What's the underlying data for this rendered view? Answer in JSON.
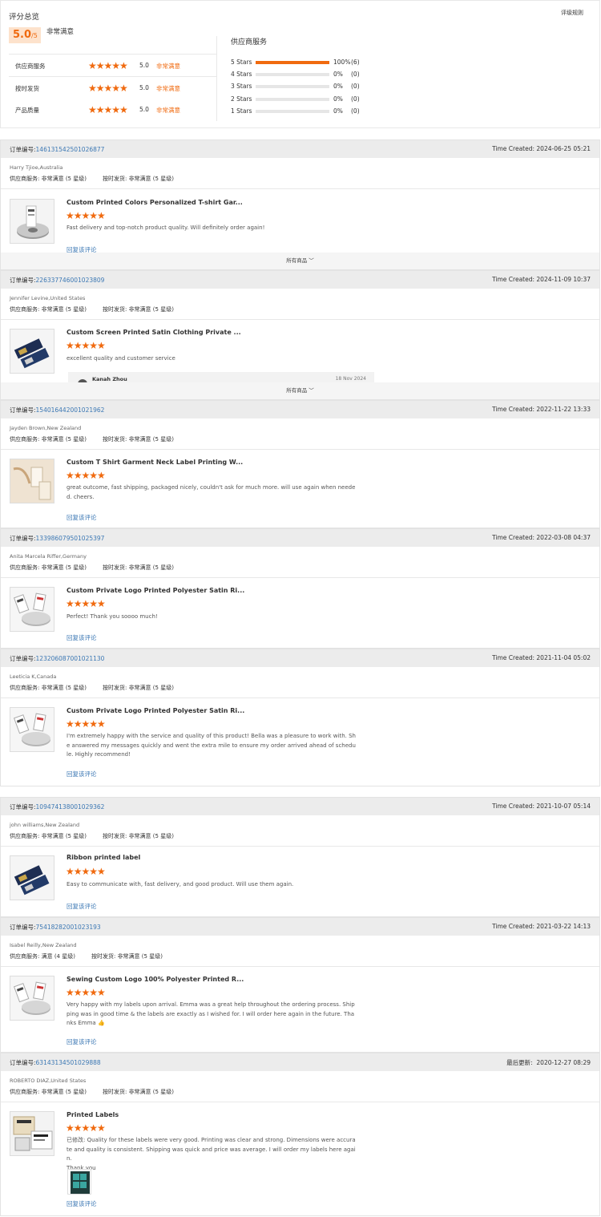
{
  "overview": {
    "title": "评分总览",
    "rules_link": "评级规则",
    "score": "5.0",
    "score_unit": "/5",
    "overall_text": "非常满意",
    "rows": [
      {
        "label": "供应商服务",
        "stars": "★★★★★",
        "value": "5.0",
        "text": "非常满意"
      },
      {
        "label": "按时发货",
        "stars": "★★★★★",
        "value": "5.0",
        "text": "非常满意"
      },
      {
        "label": "产品质量",
        "stars": "★★★★★",
        "value": "5.0",
        "text": "非常满意"
      }
    ],
    "supplier_service_title": "供应商服务",
    "distribution": [
      {
        "label": "5 Stars",
        "percent": "100%",
        "count": "(6)",
        "fraction": 1.0
      },
      {
        "label": "4 Stars",
        "percent": "0%",
        "count": "(0)",
        "fraction": 0
      },
      {
        "label": "3 Stars",
        "percent": "0%",
        "count": "(0)",
        "fraction": 0
      },
      {
        "label": "2 Stars",
        "percent": "0%",
        "count": "(0)",
        "fraction": 0
      },
      {
        "label": "1 Stars",
        "percent": "0%",
        "count": "(0)",
        "fraction": 0
      }
    ]
  },
  "labels": {
    "order_prefix": "订单编号:",
    "supplier_service": "供应商服务:",
    "on_time": "按时发货:",
    "reply": "回复该评论",
    "all_products": "所有商品"
  },
  "reviews": [
    {
      "order_no": "146131542501026877",
      "time_label": "Time Created:",
      "time": "2024-06-25 05:21",
      "user": "Harry Tjioe,Australia",
      "service_rating": "非常满意",
      "service_level": "(5 星级)",
      "ontime_rating": "非常满意",
      "ontime_level": "(5 星级)",
      "product": "Custom Printed Colors Personalized T-shirt Gar...",
      "stars": "★★★★★",
      "text": "Fast delivery and top-notch product quality. Will definitely order again!",
      "thumb": "ribbon-roll"
    },
    {
      "order_no": "226337746001023809",
      "time_label": "Time Created:",
      "time": "2024-11-09 10:37",
      "user": "Jennifer Levine,United States",
      "service_rating": "非常满意",
      "service_level": "(5 星级)",
      "ontime_rating": "非常满意",
      "ontime_level": "(5 星级)",
      "product": "Custom Screen Printed Satin Clothing Private ...",
      "stars": "★★★★★",
      "text": "excellent quality and customer service",
      "reply_name": "Kanah Zhou",
      "reply_date": "18 Nov 2024",
      "thumb": "navy-labels"
    },
    {
      "order_no": "154016442001021962",
      "time_label": "Time Created:",
      "time": "2022-11-22 13:33",
      "user": "Jayden Brown,New Zealand",
      "service_rating": "非常满意",
      "service_level": "(5 星级)",
      "ontime_rating": "非常满意",
      "ontime_level": "(5 星级)",
      "product": "Custom T Shirt Garment Neck Label Printing W...",
      "stars": "★★★★★",
      "text": "great outcome, fast shipping, packaged nicely, couldn't ask for much more. will use again when needed. cheers.",
      "thumb": "beige-labels"
    },
    {
      "order_no": "133986079501025397",
      "time_label": "Time Created:",
      "time": "2022-03-08 04:37",
      "user": "Anita Marcela Riffer,Germany",
      "service_rating": "非常满意",
      "service_level": "(5 星级)",
      "ontime_rating": "非常满意",
      "ontime_level": "(5 星级)",
      "product": "Custom Private Logo Printed Polyester Satin Ri...",
      "stars": "★★★★★",
      "text": "Perfect! Thank you soooo much!",
      "thumb": "white-tags"
    },
    {
      "order_no": "123206087001021130",
      "time_label": "Time Created:",
      "time": "2021-11-04 05:02",
      "user": "Leeticia K,Canada",
      "service_rating": "非常满意",
      "service_level": "(5 星级)",
      "ontime_rating": "非常满意",
      "ontime_level": "(5 星级)",
      "product": "Custom Private Logo Printed Polyester Satin Ri...",
      "stars": "★★★★★",
      "text": "I'm extremely happy with the service and quality of this product! Bella was a pleasure to work with. She answered my messages quickly and went the extra mile to ensure my order arrived ahead of schedule. Highly recommend!",
      "thumb": "white-tags"
    },
    {
      "order_no": "109474138001029362",
      "time_label": "Time Created:",
      "time": "2021-10-07 05:14",
      "user": "john williams,New Zealand",
      "service_rating": "非常满意",
      "service_level": "(5 星级)",
      "ontime_rating": "非常满意",
      "ontime_level": "(5 星级)",
      "product": "Ribbon printed label",
      "stars": "★★★★★",
      "text": "Easy to communicate with, fast delivery, and good product. Will use them again.",
      "thumb": "navy-labels"
    },
    {
      "order_no": "75418282001023193",
      "time_label": "Time Created:",
      "time": "2021-03-22 14:13",
      "user": "Isabel Reilly,New Zealand",
      "service_rating": "满意",
      "service_level": "(4 星级)",
      "ontime_rating": "非常满意",
      "ontime_level": "(5 星级)",
      "product": "Sewing Custom Logo 100% Polyester Printed R...",
      "stars": "★★★★★",
      "text": "Very happy with my labels upon arrival. Emma was a great help throughout the ordering process. Shipping was in good time & the labels are exactly as I wished for. I will order here again in the future. Thanks Emma 👍",
      "thumb": "white-tags"
    },
    {
      "order_no": "63143134501029888",
      "time_label": "最后更新:",
      "time": "2020-12-27 08:29",
      "user": "ROBERTO DIAZ,United States",
      "service_rating": "非常满意",
      "service_level": "(5 星级)",
      "ontime_rating": "非常满意",
      "ontime_level": "(5 星级)",
      "product": "Printed Labels",
      "stars": "★★★★★",
      "text": "已修改: Quality for these labels were very good.  Printing was clear and strong. Dimensions were accurate and quality is consistent. Shipping was quick and price was average. I will order my labels here again.\nThank you",
      "thumb": "printed-labels"
    }
  ],
  "colors": {
    "accent": "#f06a0f",
    "link": "#3c78b4",
    "header_bg": "#ececec"
  }
}
